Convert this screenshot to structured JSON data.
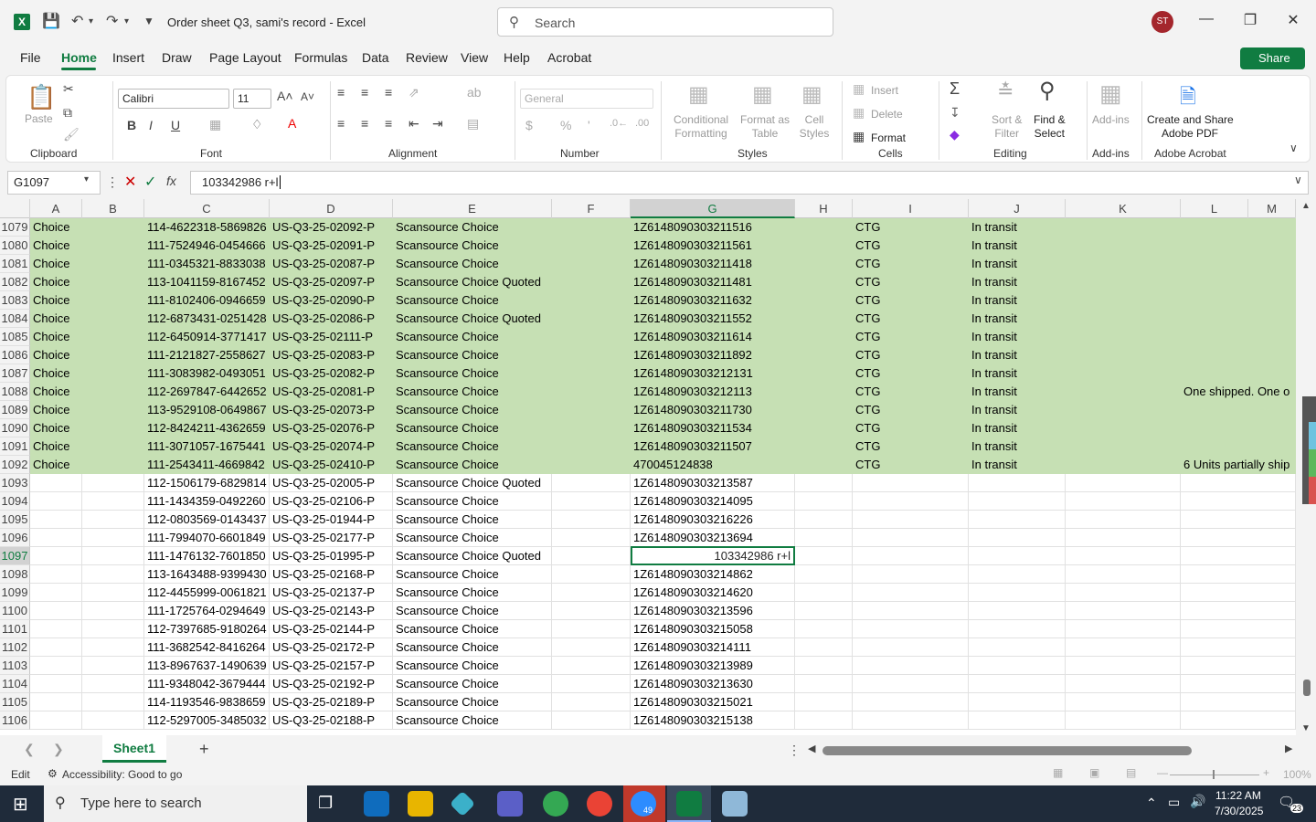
{
  "window": {
    "title": "Order sheet Q3, sami's record  -  Excel",
    "search_placeholder": "Search",
    "user_initials": "ST"
  },
  "menu": [
    "File",
    "Home",
    "Insert",
    "Draw",
    "Page Layout",
    "Formulas",
    "Data",
    "Review",
    "View",
    "Help",
    "Acrobat"
  ],
  "share_label": "Share",
  "ribbon": {
    "paste": "Paste",
    "clipboard": "Clipboard",
    "font_name": "Calibri",
    "font_size": "11",
    "font": "Font",
    "alignment": "Alignment",
    "number_format": "General",
    "number": "Number",
    "conditional": "Conditional\nFormatting",
    "format_table": "Format as\nTable",
    "cell_styles": "Cell\nStyles",
    "styles": "Styles",
    "insert": "Insert",
    "delete": "Delete",
    "format": "Format",
    "cells": "Cells",
    "sort_filter": "Sort &\nFilter",
    "find_select": "Find &\nSelect",
    "editing": "Editing",
    "addins_btn": "Add-ins",
    "addins": "Add-ins",
    "create_pdf": "Create and Share\nAdobe PDF",
    "acrobat": "Adobe Acrobat"
  },
  "formula": {
    "name_box": "G1097",
    "content": "103342986 r+l"
  },
  "columns": [
    "A",
    "B",
    "C",
    "D",
    "E",
    "F",
    "G",
    "H",
    "I",
    "J",
    "K",
    "L",
    "M"
  ],
  "rows": [
    {
      "n": "1079",
      "a": "Choice",
      "c": "114-4622318-5869826",
      "d": "US-Q3-25-02092-P",
      "e": "Scansource Choice",
      "g": "1Z6148090303211516",
      "i": "CTG",
      "j": "In transit",
      "l": ""
    },
    {
      "n": "1080",
      "a": "Choice",
      "c": "111-7524946-0454666",
      "d": "US-Q3-25-02091-P",
      "e": "Scansource Choice",
      "g": "1Z6148090303211561",
      "i": "CTG",
      "j": "In transit",
      "l": ""
    },
    {
      "n": "1081",
      "a": "Choice",
      "c": "111-0345321-8833038",
      "d": "US-Q3-25-02087-P",
      "e": "Scansource Choice",
      "g": "1Z6148090303211418",
      "i": "CTG",
      "j": "In transit",
      "l": ""
    },
    {
      "n": "1082",
      "a": "Choice",
      "c": "113-1041159-8167452",
      "d": "US-Q3-25-02097-P",
      "e": "Scansource Choice Quoted",
      "g": "1Z6148090303211481",
      "i": "CTG",
      "j": "In transit",
      "l": ""
    },
    {
      "n": "1083",
      "a": "Choice",
      "c": "111-8102406-0946659",
      "d": "US-Q3-25-02090-P",
      "e": "Scansource Choice",
      "g": "1Z6148090303211632",
      "i": "CTG",
      "j": "In transit",
      "l": ""
    },
    {
      "n": "1084",
      "a": "Choice",
      "c": "112-6873431-0251428",
      "d": "US-Q3-25-02086-P",
      "e": "Scansource Choice Quoted",
      "g": "1Z6148090303211552",
      "i": "CTG",
      "j": "In transit",
      "l": ""
    },
    {
      "n": "1085",
      "a": "Choice",
      "c": "112-6450914-3771417",
      "d": "US-Q3-25-02111-P",
      "e": "Scansource Choice",
      "g": "1Z6148090303211614",
      "i": "CTG",
      "j": "In transit",
      "l": ""
    },
    {
      "n": "1086",
      "a": "Choice",
      "c": "111-2121827-2558627",
      "d": "US-Q3-25-02083-P",
      "e": "Scansource Choice",
      "g": "1Z6148090303211892",
      "i": "CTG",
      "j": "In transit",
      "l": ""
    },
    {
      "n": "1087",
      "a": "Choice",
      "c": "111-3083982-0493051",
      "d": "US-Q3-25-02082-P",
      "e": "Scansource Choice",
      "g": "1Z6148090303212131",
      "i": "CTG",
      "j": "In transit",
      "l": ""
    },
    {
      "n": "1088",
      "a": "Choice",
      "c": "112-2697847-6442652",
      "d": "US-Q3-25-02081-P",
      "e": "Scansource Choice",
      "g": "1Z6148090303212113",
      "i": "CTG",
      "j": "In transit",
      "l": "One shipped. One o"
    },
    {
      "n": "1089",
      "a": "Choice",
      "c": "113-9529108-0649867",
      "d": "US-Q3-25-02073-P",
      "e": "Scansource Choice",
      "g": "1Z6148090303211730",
      "i": "CTG",
      "j": "In transit",
      "l": ""
    },
    {
      "n": "1090",
      "a": "Choice",
      "c": "112-8424211-4362659",
      "d": "US-Q3-25-02076-P",
      "e": "Scansource Choice",
      "g": "1Z6148090303211534",
      "i": "CTG",
      "j": "In transit",
      "l": ""
    },
    {
      "n": "1091",
      "a": "Choice",
      "c": "111-3071057-1675441",
      "d": "US-Q3-25-02074-P",
      "e": "Scansource Choice",
      "g": "1Z6148090303211507",
      "i": "CTG",
      "j": "In transit",
      "l": ""
    },
    {
      "n": "1092",
      "a": "Choice",
      "c": "111-2543411-4669842",
      "d": "US-Q3-25-02410-P",
      "e": "Scansource Choice",
      "g": "470045124838",
      "i": "CTG",
      "j": "In transit",
      "l": "6 Units partially ship"
    },
    {
      "n": "1093",
      "a": "",
      "c": "112-1506179-6829814",
      "d": "US-Q3-25-02005-P",
      "e": "Scansource Choice Quoted",
      "g": "1Z6148090303213587",
      "i": "",
      "j": "",
      "l": ""
    },
    {
      "n": "1094",
      "a": "",
      "c": "111-1434359-0492260",
      "d": "US-Q3-25-02106-P",
      "e": "Scansource Choice",
      "g": "1Z6148090303214095",
      "i": "",
      "j": "",
      "l": ""
    },
    {
      "n": "1095",
      "a": "",
      "c": "112-0803569-0143437",
      "d": "US-Q3-25-01944-P",
      "e": "Scansource Choice",
      "g": "1Z6148090303216226",
      "i": "",
      "j": "",
      "l": ""
    },
    {
      "n": "1096",
      "a": "",
      "c": "111-7994070-6601849",
      "d": "US-Q3-25-02177-P",
      "e": "Scansource Choice",
      "g": "1Z6148090303213694",
      "i": "",
      "j": "",
      "l": ""
    },
    {
      "n": "1097",
      "a": "",
      "c": "111-1476132-7601850",
      "d": "US-Q3-25-01995-P",
      "e": "Scansource Choice Quoted",
      "g": "",
      "i": "",
      "j": "",
      "l": ""
    },
    {
      "n": "1098",
      "a": "",
      "c": "113-1643488-9399430",
      "d": "US-Q3-25-02168-P",
      "e": "Scansource Choice",
      "g": "1Z6148090303214862",
      "i": "",
      "j": "",
      "l": ""
    },
    {
      "n": "1099",
      "a": "",
      "c": "112-4455999-0061821",
      "d": "US-Q3-25-02137-P",
      "e": "Scansource Choice",
      "g": "1Z6148090303214620",
      "i": "",
      "j": "",
      "l": ""
    },
    {
      "n": "1100",
      "a": "",
      "c": "111-1725764-0294649",
      "d": "US-Q3-25-02143-P",
      "e": "Scansource Choice",
      "g": "1Z6148090303213596",
      "i": "",
      "j": "",
      "l": ""
    },
    {
      "n": "1101",
      "a": "",
      "c": "112-7397685-9180264",
      "d": "US-Q3-25-02144-P",
      "e": "Scansource Choice",
      "g": "1Z6148090303215058",
      "i": "",
      "j": "",
      "l": ""
    },
    {
      "n": "1102",
      "a": "",
      "c": "111-3682542-8416264",
      "d": "US-Q3-25-02172-P",
      "e": "Scansource Choice",
      "g": "1Z6148090303214111",
      "i": "",
      "j": "",
      "l": ""
    },
    {
      "n": "1103",
      "a": "",
      "c": "113-8967637-1490639",
      "d": "US-Q3-25-02157-P",
      "e": "Scansource Choice",
      "g": "1Z6148090303213989",
      "i": "",
      "j": "",
      "l": ""
    },
    {
      "n": "1104",
      "a": "",
      "c": "111-9348042-3679444",
      "d": "US-Q3-25-02192-P",
      "e": "Scansource Choice",
      "g": "1Z6148090303213630",
      "i": "",
      "j": "",
      "l": ""
    },
    {
      "n": "1105",
      "a": "",
      "c": "114-1193546-9838659",
      "d": "US-Q3-25-02189-P",
      "e": "Scansource Choice",
      "g": "1Z6148090303215021",
      "i": "",
      "j": "",
      "l": ""
    },
    {
      "n": "1106",
      "a": "",
      "c": "112-5297005-3485032",
      "d": "US-Q3-25-02188-P",
      "e": "Scansource Choice",
      "g": "1Z6148090303215138",
      "i": "",
      "j": "",
      "l": ""
    }
  ],
  "active_cell_value": "103342986 r+l",
  "sheet_tab": "Sheet1",
  "status": {
    "mode": "Edit",
    "accessibility": "Accessibility: Good to go",
    "zoom": "100%"
  },
  "taskbar": {
    "search_placeholder": "Type here to search",
    "time": "11:22 AM",
    "date": "7/30/2025",
    "notifications": "23",
    "zoom_badge": "49"
  },
  "colors": {
    "accent": "#107c41",
    "highlight": "#c6e0b4"
  }
}
